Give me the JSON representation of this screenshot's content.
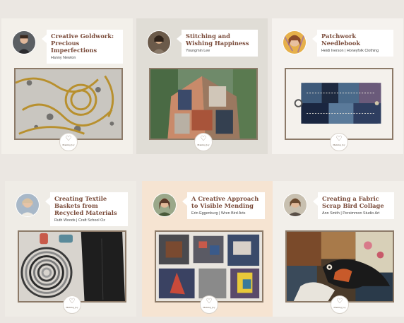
{
  "cards": [
    {
      "title": "Creative Goldwork: Precious Imperfections",
      "subtitle": "Hanny Newton",
      "logo_text": "Making Joy"
    },
    {
      "title": "Stitching and Wishing Happiness",
      "subtitle": "Youngmin Lee",
      "logo_text": "Making Joy"
    },
    {
      "title": "Patchwork Needlebook",
      "subtitle": "Heidi Iverson | Honeyfolk Clothing",
      "logo_text": "Making Joy"
    },
    {
      "title": "Creating Textile Baskets from Recycled Materials",
      "subtitle": "Ruth Woods | Craft School Oz",
      "logo_text": "Making Joy"
    },
    {
      "title": "A Creative Approach to Visible Mending",
      "subtitle": "Erin Eggenburg | Wren Bird Arts",
      "logo_text": "Making Joy"
    },
    {
      "title": "Creating a Fabric Scrap Bird Collage",
      "subtitle": "Ann Smith | Persimmon Studio Art",
      "logo_text": "Making Joy"
    }
  ]
}
